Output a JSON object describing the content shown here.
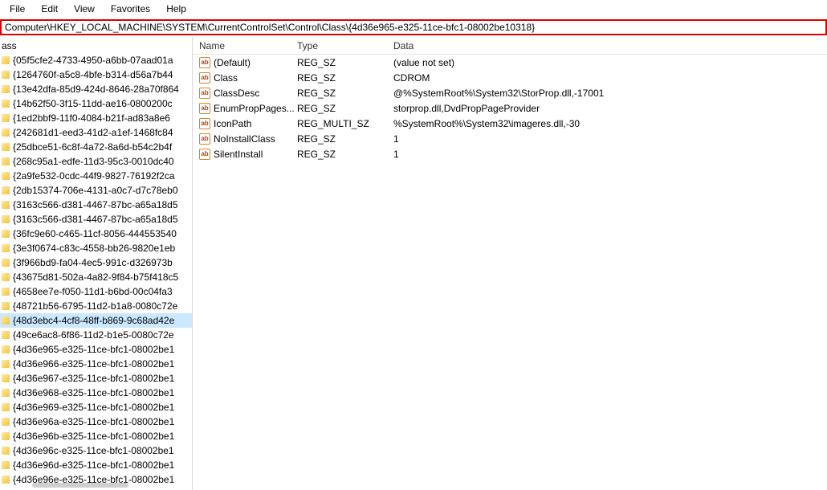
{
  "menu": {
    "items": [
      "File",
      "Edit",
      "View",
      "Favorites",
      "Help"
    ]
  },
  "address": "Computer\\HKEY_LOCAL_MACHINE\\SYSTEM\\CurrentControlSet\\Control\\Class\\{4d36e965-e325-11ce-bfc1-08002be10318}",
  "tree": {
    "header": "ass",
    "selected_index": 18,
    "items": [
      "{05f5cfe2-4733-4950-a6bb-07aad01a",
      "{1264760f-a5c8-4bfe-b314-d56a7b44",
      "{13e42dfa-85d9-424d-8646-28a70f864",
      "{14b62f50-3f15-11dd-ae16-0800200c",
      "{1ed2bbf9-11f0-4084-b21f-ad83a8e6",
      "{242681d1-eed3-41d2-a1ef-1468fc84",
      "{25dbce51-6c8f-4a72-8a6d-b54c2b4f",
      "{268c95a1-edfe-11d3-95c3-0010dc40",
      "{2a9fe532-0cdc-44f9-9827-76192f2ca",
      "{2db15374-706e-4131-a0c7-d7c78eb0",
      "{3163c566-d381-4467-87bc-a65a18d5",
      "{3163c566-d381-4467-87bc-a65a18d5",
      "{36fc9e60-c465-11cf-8056-444553540",
      "{3e3f0674-c83c-4558-bb26-9820e1eb",
      "{3f966bd9-fa04-4ec5-991c-d326973b",
      "{43675d81-502a-4a82-9f84-b75f418c5",
      "{4658ee7e-f050-11d1-b6bd-00c04fa3",
      "{48721b56-6795-11d2-b1a8-0080c72e",
      "{48d3ebc4-4cf8-48ff-b869-9c68ad42e",
      "{49ce6ac8-6f86-11d2-b1e5-0080c72e",
      "{4d36e965-e325-11ce-bfc1-08002be1",
      "{4d36e966-e325-11ce-bfc1-08002be1",
      "{4d36e967-e325-11ce-bfc1-08002be1",
      "{4d36e968-e325-11ce-bfc1-08002be1",
      "{4d36e969-e325-11ce-bfc1-08002be1",
      "{4d36e96a-e325-11ce-bfc1-08002be1",
      "{4d36e96b-e325-11ce-bfc1-08002be1",
      "{4d36e96c-e325-11ce-bfc1-08002be1",
      "{4d36e96d-e325-11ce-bfc1-08002be1",
      "{4d36e96e-e325-11ce-bfc1-08002be1"
    ]
  },
  "list": {
    "columns": {
      "name": "Name",
      "type": "Type",
      "data": "Data"
    },
    "rows": [
      {
        "name": "(Default)",
        "type": "REG_SZ",
        "data": "(value not set)"
      },
      {
        "name": "Class",
        "type": "REG_SZ",
        "data": "CDROM"
      },
      {
        "name": "ClassDesc",
        "type": "REG_SZ",
        "data": "@%SystemRoot%\\System32\\StorProp.dll,-17001"
      },
      {
        "name": "EnumPropPages...",
        "type": "REG_SZ",
        "data": "storprop.dll,DvdPropPageProvider"
      },
      {
        "name": "IconPath",
        "type": "REG_MULTI_SZ",
        "data": "%SystemRoot%\\System32\\imageres.dll,-30"
      },
      {
        "name": "NoInstallClass",
        "type": "REG_SZ",
        "data": "1"
      },
      {
        "name": "SilentInstall",
        "type": "REG_SZ",
        "data": "1"
      }
    ]
  },
  "icon_glyph": "ab"
}
